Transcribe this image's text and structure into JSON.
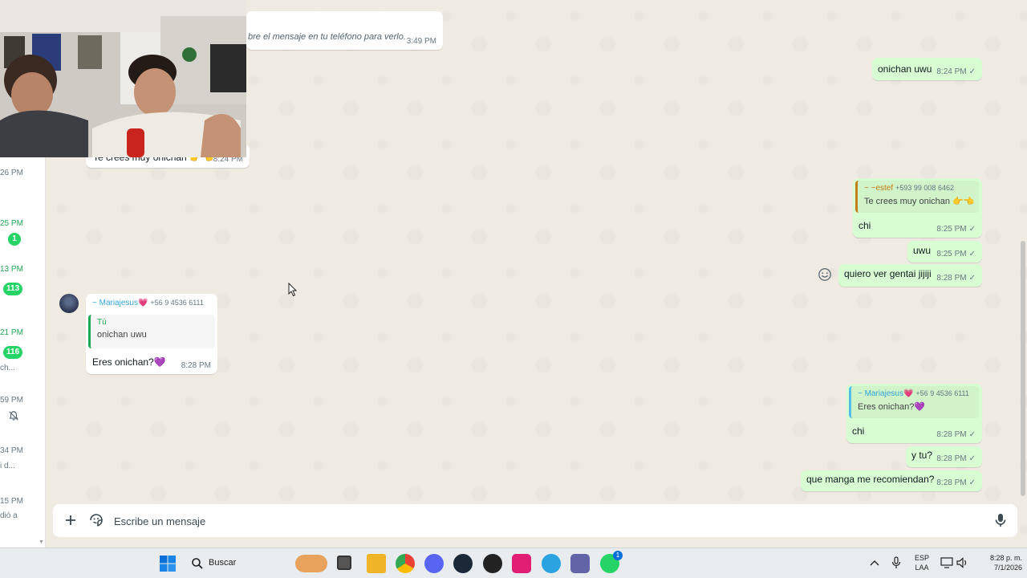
{
  "chat_list": {
    "times": [
      "26 PM",
      "25 PM",
      "13 PM",
      "21 PM",
      "59 PM",
      "34 PM",
      "15 PM"
    ],
    "badges": [
      "1",
      "113",
      "116"
    ],
    "previews": [
      "ch...",
      "i d...",
      "dió a"
    ]
  },
  "messages": {
    "m1": {
      "text": "bre el mensaje en tu teléfono para verlo.",
      "time": "3:49 PM"
    },
    "m2": {
      "text": "onichan uwu",
      "time": "8:24 PM"
    },
    "m3": {
      "text": "Te crees muy onichan 👉👈",
      "time": "8:24 PM"
    },
    "m4": {
      "quote_author": "~ ~estef",
      "quote_phone": "+593 99 008 6462",
      "quote_text": "Te crees muy onichan 👉👈",
      "text": "chi",
      "time": "8:25 PM"
    },
    "m5": {
      "text": "uwu",
      "time": "8:25 PM"
    },
    "m6": {
      "text": "quiero ver gentai jijiji",
      "time": "8:28 PM"
    },
    "m7": {
      "sender": "~ Mariajesus💗",
      "phone": "+56 9 4536 6111",
      "quote_author": "Tú",
      "quote_text": "onichan uwu",
      "text": "Eres onichan?💜",
      "time": "8:28 PM"
    },
    "m8": {
      "quote_author": "~ Mariajesus💗",
      "quote_phone": "+56 9 4536 6111",
      "quote_text": "Eres onichan?💜",
      "text": "chi",
      "time": "8:28 PM"
    },
    "m9": {
      "text": "y tu?",
      "time": "8:28 PM"
    },
    "m10": {
      "text": "que manga me recomiendan?",
      "time": "8:28 PM"
    }
  },
  "tick": "✓",
  "composer": {
    "placeholder": "Escribe un mensaje"
  },
  "taskbar": {
    "search_label": "Buscar",
    "lang": "ESP",
    "layout": "LAA",
    "time": "8:28 p. m.",
    "date": "7/1/2026",
    "whatsapp_badge": "1"
  },
  "colors": {
    "in_bubble": "#ffffff",
    "out_bubble": "#d9fdd3",
    "badge": "#25d366",
    "quote_orange": "#c27f1a",
    "quote_teal": "#53bdeb"
  }
}
